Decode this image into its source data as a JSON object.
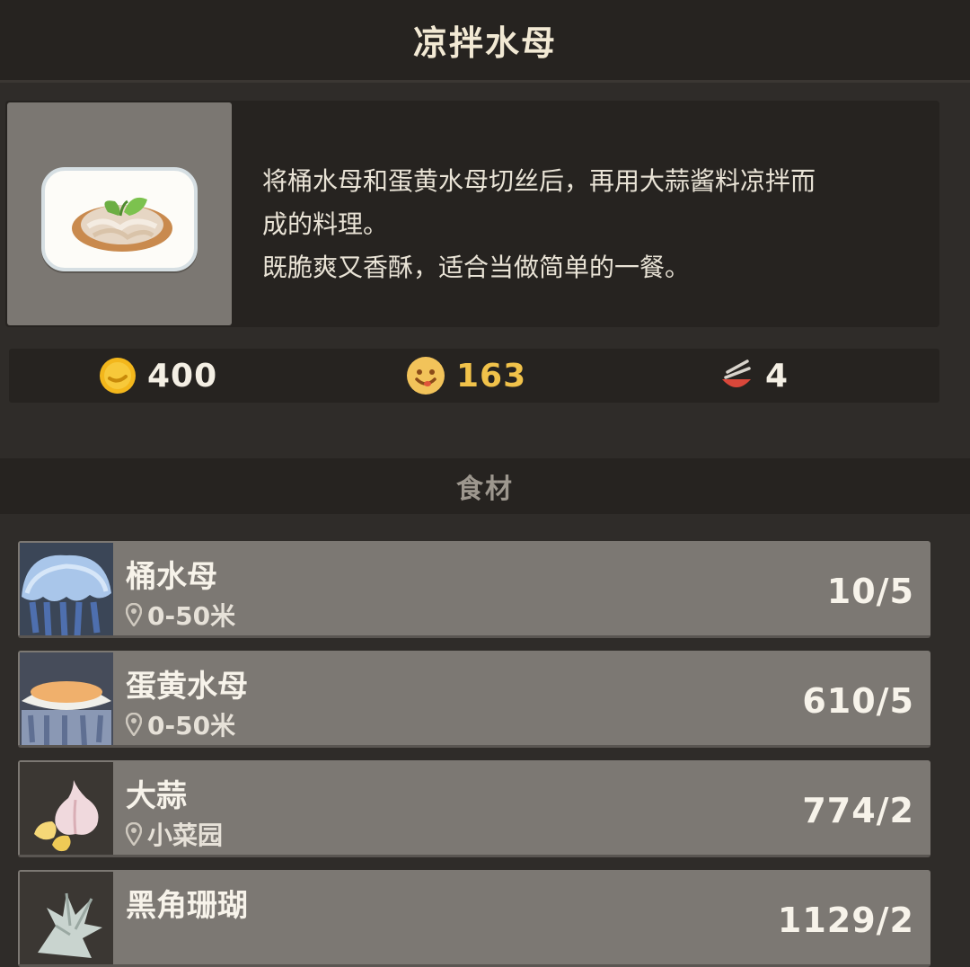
{
  "header": {
    "title": "凉拌水母"
  },
  "dish": {
    "image_icon": "cold-jellyfish-dish-icon",
    "description": [
      "将桶水母和蛋黄水母切丝后，再用大蒜酱料凉拌而",
      "成的料理。",
      "既脆爽又香酥，适合当做简单的一餐。"
    ]
  },
  "stats": {
    "price": {
      "icon": "gold-coin-icon",
      "value": "400"
    },
    "popularity": {
      "icon": "smiley-face-icon",
      "value": "163"
    },
    "taste": {
      "icon": "bowl-chopsticks-icon",
      "value": "4"
    }
  },
  "ingredients_section": {
    "label": "食材"
  },
  "ingredients": [
    {
      "name": "桶水母",
      "location": "0-50米",
      "count": "10/5",
      "icon": "bucket-jellyfish-icon"
    },
    {
      "name": "蛋黄水母",
      "location": "0-50米",
      "count": "610/5",
      "icon": "egg-yolk-jellyfish-icon"
    },
    {
      "name": "大蒜",
      "location": "小菜园",
      "count": "774/2",
      "icon": "garlic-icon"
    },
    {
      "name": "黑角珊瑚",
      "location": "",
      "count": "1129/2",
      "icon": "black-coral-icon"
    }
  ],
  "colors": {
    "background": "#2f2c29",
    "panel": "#262320",
    "row": "#7c7873",
    "popularity_value": "#f1c24a",
    "coin": "#f3b71c"
  }
}
